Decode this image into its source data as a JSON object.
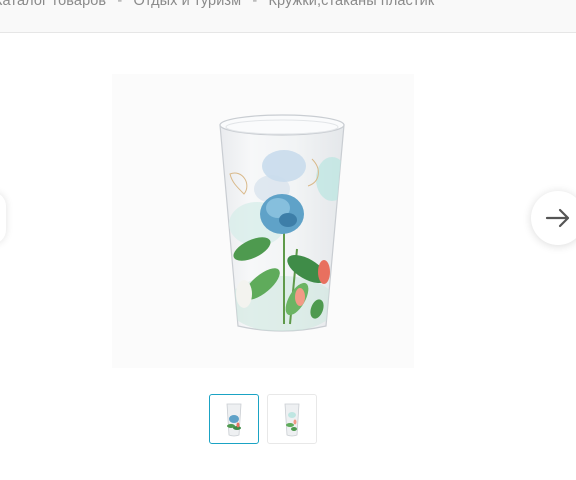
{
  "breadcrumb": {
    "items": [
      "Каталог товаров",
      "Отдых и туризм",
      "Кружки,стаканы пластик"
    ],
    "separator": "-"
  },
  "gallery": {
    "main_image": "decorated-plastic-cup-hydrangea-print",
    "next_icon": "arrow-right-icon",
    "thumbnails": [
      {
        "image": "cup-thumbnail-front",
        "selected": true
      },
      {
        "image": "cup-thumbnail-side",
        "selected": false
      }
    ],
    "accent_color": "#1aa3c4"
  }
}
